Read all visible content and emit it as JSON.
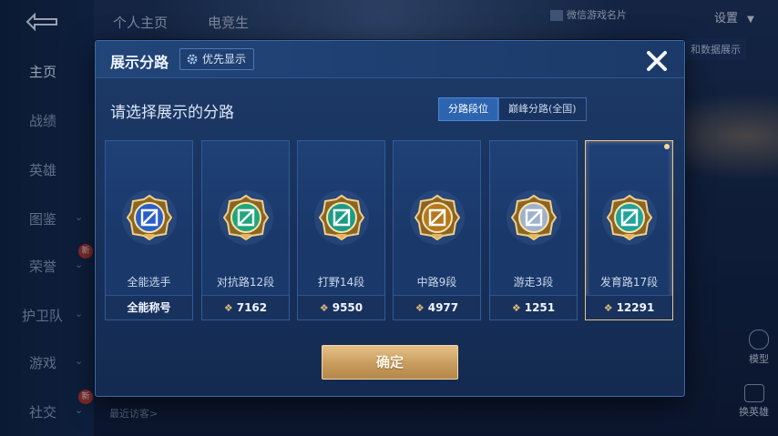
{
  "background": {
    "tabs": [
      "个人主页",
      "电竞生"
    ],
    "top_right": {
      "card_label": "微信游戏名片",
      "settings": "设置",
      "data_btn": "和数据展示"
    },
    "sidebar": [
      {
        "label": "主页",
        "active": true,
        "chevron": false,
        "badge": ""
      },
      {
        "label": "战绩",
        "active": false,
        "chevron": false,
        "badge": ""
      },
      {
        "label": "英雄",
        "active": false,
        "chevron": false,
        "badge": ""
      },
      {
        "label": "图鉴",
        "active": false,
        "chevron": true,
        "badge": ""
      },
      {
        "label": "荣誉",
        "active": false,
        "chevron": true,
        "badge": "新"
      },
      {
        "label": "护卫队",
        "active": false,
        "chevron": true,
        "badge": ""
      },
      {
        "label": "游戏",
        "active": false,
        "chevron": true,
        "badge": ""
      },
      {
        "label": "社交",
        "active": false,
        "chevron": true,
        "badge": "新"
      }
    ],
    "recent_visitors": "最近访客>",
    "right_buttons": {
      "model": "模型",
      "swap_hero": "换英雄"
    }
  },
  "dialog": {
    "title": "展示分路",
    "priority_button": "优先显示",
    "subtitle": "请选择展示的分路",
    "segments": [
      {
        "label": "分路段位",
        "selected": true
      },
      {
        "label": "巅峰分路(全国)",
        "selected": false
      }
    ],
    "cards": [
      {
        "name": "全能选手",
        "value": "全能称号",
        "show_diamond": false,
        "selected": false,
        "icon": "all-round-emblem-icon",
        "color": "#2a5fc9"
      },
      {
        "name": "对抗路12段",
        "value": "7162",
        "show_diamond": true,
        "selected": false,
        "icon": "clash-lane-emblem-icon",
        "color": "#1fa67a"
      },
      {
        "name": "打野14段",
        "value": "9550",
        "show_diamond": true,
        "selected": false,
        "icon": "jungle-emblem-icon",
        "color": "#1a9c86"
      },
      {
        "name": "中路9段",
        "value": "4977",
        "show_diamond": true,
        "selected": false,
        "icon": "mid-lane-emblem-icon",
        "color": "#b5781e"
      },
      {
        "name": "游走3段",
        "value": "1251",
        "show_diamond": true,
        "selected": false,
        "icon": "roam-emblem-icon",
        "color": "#9fb2cc"
      },
      {
        "name": "发育路17段",
        "value": "12291",
        "show_diamond": true,
        "selected": true,
        "icon": "farm-lane-emblem-icon",
        "color": "#1fa39a"
      }
    ],
    "confirm_button": "确定"
  }
}
